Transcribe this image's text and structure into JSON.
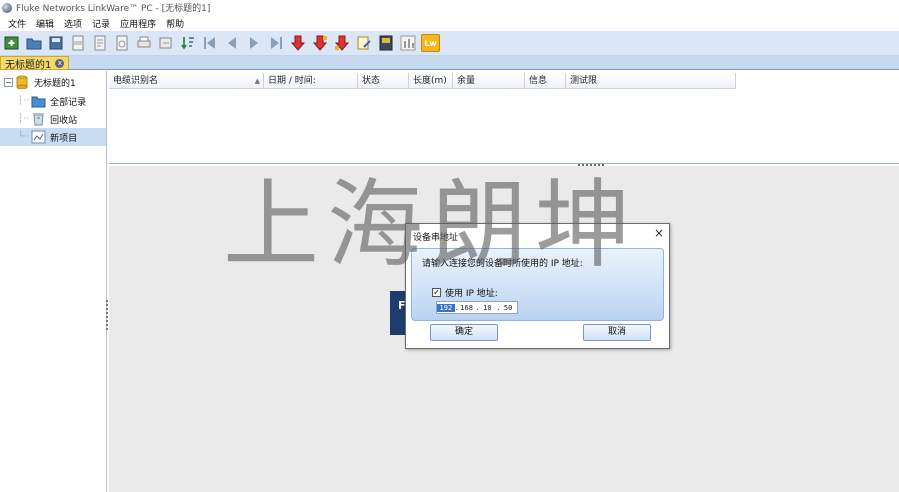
{
  "window": {
    "title": "Fluke Networks LinkWare™ PC - [无标题的1]"
  },
  "menu": [
    "文件",
    "编辑",
    "选项",
    "记录",
    "应用程序",
    "帮助"
  ],
  "toolbar": {
    "buttons": [
      {
        "icon": "new-icon"
      },
      {
        "icon": "open-icon"
      },
      {
        "icon": "save-icon"
      },
      {
        "icon": "pdf-icon"
      },
      {
        "icon": "export-icon"
      },
      {
        "icon": "report-icon"
      },
      {
        "icon": "print-icon"
      },
      {
        "icon": "refresh-icon"
      },
      {
        "icon": "sort-icon"
      },
      {
        "icon": "first-icon"
      },
      {
        "icon": "prev-icon"
      },
      {
        "icon": "next-icon"
      },
      {
        "icon": "last-icon"
      },
      {
        "icon": "import-down-icon"
      },
      {
        "icon": "import-down2-icon"
      },
      {
        "icon": "import-down3-icon"
      },
      {
        "icon": "edit-icon"
      },
      {
        "icon": "tester-icon"
      },
      {
        "icon": "chart-icon"
      }
    ],
    "lw_label": "Lw"
  },
  "tab": {
    "label": "无标题的1"
  },
  "tree": {
    "root": "无标题的1",
    "items": [
      "全部记录",
      "回收站",
      "新项目"
    ]
  },
  "table": {
    "columns": [
      "电缆识别名",
      "日期 / 时间:",
      "状态",
      "长度(m)",
      "余量",
      "信息",
      "测试限"
    ]
  },
  "watermark": "上海朗坤",
  "splash": {
    "letter": "F"
  },
  "dialog": {
    "title": "设备串地址",
    "close": "×",
    "prompt": "请输入连接您的设备时所使用的 IP 地址:",
    "checkbox_label": "使用 IP 地址:",
    "checkbox_mark": "✓",
    "ip": [
      "192",
      "168",
      "10",
      "50"
    ],
    "ok": "确定",
    "cancel": "取消"
  },
  "colors": {
    "toolbar": "#dbe7f6",
    "tab_active": "#f4d86a",
    "selection": "#c8dcf2",
    "dialog_panel": "#cfe1f7",
    "watermark": "#5f5f5f"
  }
}
